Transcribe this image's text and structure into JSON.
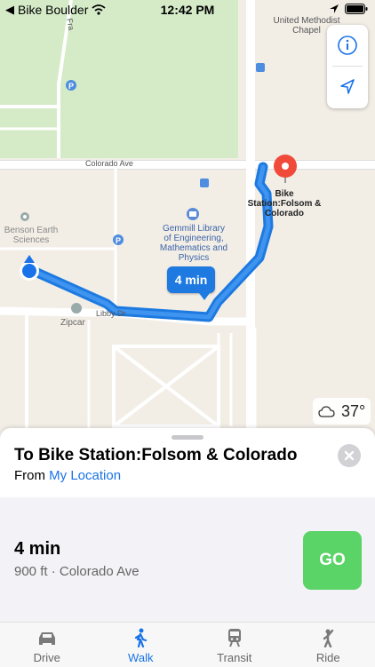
{
  "status_bar": {
    "back_app": "Bike Boulder",
    "time": "12:42 PM"
  },
  "map": {
    "labels": {
      "church": "United Methodist\nChapel",
      "street_colorado": "Colorado Ave",
      "destination": "Bike\nStation:Folsom &\nColorado",
      "library": "Gemmill Library\nof Engineering,\nMathematics and\nPhysics",
      "benson": "Benson Earth\nSciences",
      "libby": "Libby Dr",
      "zipcar": "Zipcar",
      "fra": "Fra"
    },
    "eta_bubble": "4 min",
    "weather": {
      "temperature": "37°",
      "icon": "cloud-icon"
    },
    "colors": {
      "route": "#1e7ae0",
      "pin": "#f04a3a",
      "park": "#d5ebc8",
      "location_dot": "#1a73e8"
    }
  },
  "directions": {
    "title": "To Bike Station:Folsom & Colorado",
    "from_label": "From",
    "from_value": "My Location",
    "route": {
      "time": "4 min",
      "detail": "900 ft · Colorado Ave",
      "go_label": "GO"
    }
  },
  "tabs": [
    {
      "label": "Drive",
      "icon": "car-icon",
      "active": false
    },
    {
      "label": "Walk",
      "icon": "walk-icon",
      "active": true
    },
    {
      "label": "Transit",
      "icon": "train-icon",
      "active": false
    },
    {
      "label": "Ride",
      "icon": "ride-icon",
      "active": false
    }
  ]
}
